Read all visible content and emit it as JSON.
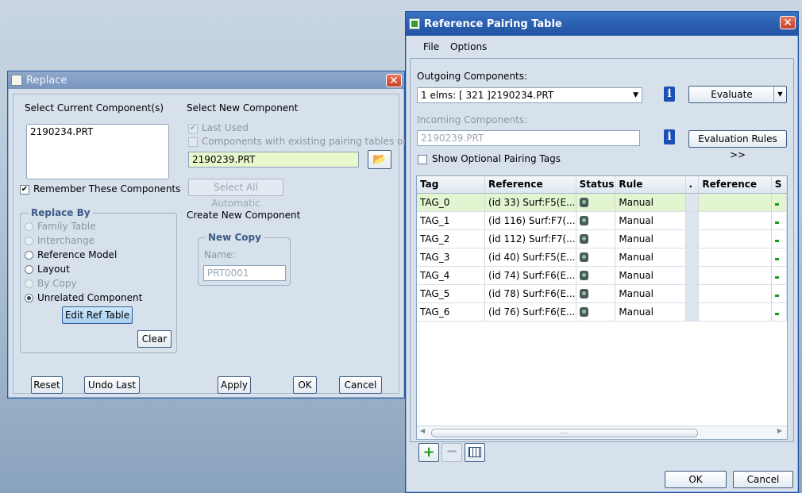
{
  "replace": {
    "title": "Replace",
    "select_current_label": "Select Current Component(s)",
    "current_list": [
      "2190234.PRT"
    ],
    "remember_label": "Remember These Components",
    "replace_by_title": "Replace By",
    "options": [
      "Family Table",
      "Interchange",
      "Reference Model",
      "Layout",
      "By Copy",
      "Unrelated Component"
    ],
    "edit_ref_table": "Edit Ref Table",
    "clear": "Clear",
    "select_new_label": "Select New Component",
    "last_used": "Last Used",
    "existing_pairing": "Components with existing pairing tables only",
    "new_component_value": "2190239.PRT",
    "select_all_automatic": "Select All Automatic",
    "create_new_label": "Create New Component",
    "new_copy_title": "New Copy",
    "name_label": "Name:",
    "name_value": "PRT0001",
    "reset": "Reset",
    "undo_last": "Undo Last",
    "apply": "Apply",
    "ok": "OK",
    "cancel": "Cancel"
  },
  "rpt": {
    "title": "Reference Pairing Table",
    "menu": [
      "File",
      "Options"
    ],
    "outgoing_label": "Outgoing Components:",
    "outgoing_value": "1 elms: [ 321 ]2190234.PRT",
    "evaluate": "Evaluate",
    "incoming_label": "Incoming Components:",
    "incoming_value": "2190239.PRT",
    "eval_rules": "Evaluation Rules >>",
    "show_optional": "Show Optional Pairing Tags",
    "columns": [
      "Tag",
      "Reference",
      "Status",
      "Rule",
      ".",
      "Reference",
      "S"
    ],
    "rows": [
      {
        "tag": "TAG_0",
        "ref": "(id 33) Surf:F5(E...",
        "rule": "Manual"
      },
      {
        "tag": "TAG_1",
        "ref": "(id 116) Surf:F7(...",
        "rule": "Manual"
      },
      {
        "tag": "TAG_2",
        "ref": "(id 112) Surf:F7(...",
        "rule": "Manual"
      },
      {
        "tag": "TAG_3",
        "ref": "(id 40) Surf:F5(E...",
        "rule": "Manual"
      },
      {
        "tag": "TAG_4",
        "ref": "(id 74) Surf:F6(E...",
        "rule": "Manual"
      },
      {
        "tag": "TAG_5",
        "ref": "(id 78) Surf:F6(E...",
        "rule": "Manual"
      },
      {
        "tag": "TAG_6",
        "ref": "(id 76) Surf:F6(E...",
        "rule": "Manual"
      }
    ],
    "scroll_grip": "....",
    "ok": "OK",
    "cancel": "Cancel"
  },
  "colors": {
    "selected_row": "#e2f5d0",
    "title_active": "#2a5fb0",
    "field_green": "#e8f7cc"
  },
  "icons": [
    "close-icon",
    "open-folder-icon",
    "info-icon",
    "lock-icon",
    "add-icon",
    "remove-icon",
    "table-columns-icon"
  ]
}
